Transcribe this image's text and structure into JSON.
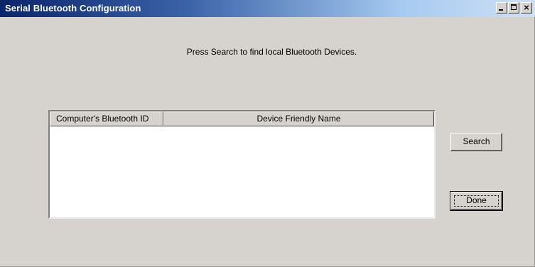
{
  "window": {
    "title": "Serial Bluetooth Configuration",
    "caption_buttons": {
      "minimize_icon": "minimize-icon",
      "maximize_icon": "maximize-icon",
      "close_icon": "close-icon",
      "close_glyph": "×"
    }
  },
  "instruction": "Press Search to find local Bluetooth Devices.",
  "device_list": {
    "columns": [
      "Computer's Bluetooth ID",
      "Device Friendly Name"
    ],
    "rows": []
  },
  "buttons": {
    "search_label": "Search",
    "done_label": "Done"
  },
  "colors": {
    "titlebar_start": "#0a246a",
    "titlebar_end": "#cfe0f6",
    "face": "#d6d3ce"
  }
}
